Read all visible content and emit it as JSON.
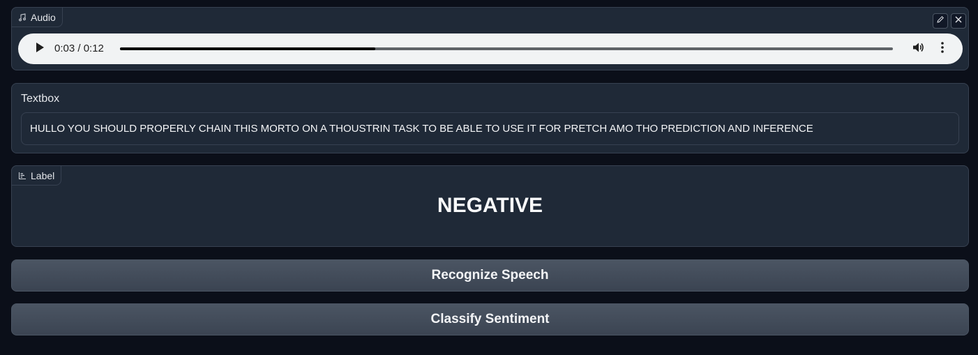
{
  "audio": {
    "label": "Audio",
    "current_time": "0:03",
    "duration": "0:12",
    "time_display": "0:03 / 0:12",
    "progress_fraction": 0.33,
    "icons": [
      "music-note-icon",
      "edit-icon",
      "close-icon",
      "play-icon",
      "volume-icon",
      "more-options-icon"
    ]
  },
  "textbox": {
    "label": "Textbox",
    "value": "HULLO YOU SHOULD PROPERLY CHAIN THIS MORTO ON A THOUSTRIN TASK TO BE ABLE TO USE IT FOR PRETCH AMO THO PREDICTION AND INFERENCE"
  },
  "label_output": {
    "label": "Label",
    "value": "NEGATIVE",
    "icon": "bar-chart-icon"
  },
  "buttons": {
    "recognize": "Recognize Speech",
    "classify": "Classify Sentiment"
  },
  "colors": {
    "background": "#0b0f19",
    "panel": "#1f2937",
    "border": "#374151",
    "button": "#4b5563",
    "player": "#f1f3f4"
  }
}
